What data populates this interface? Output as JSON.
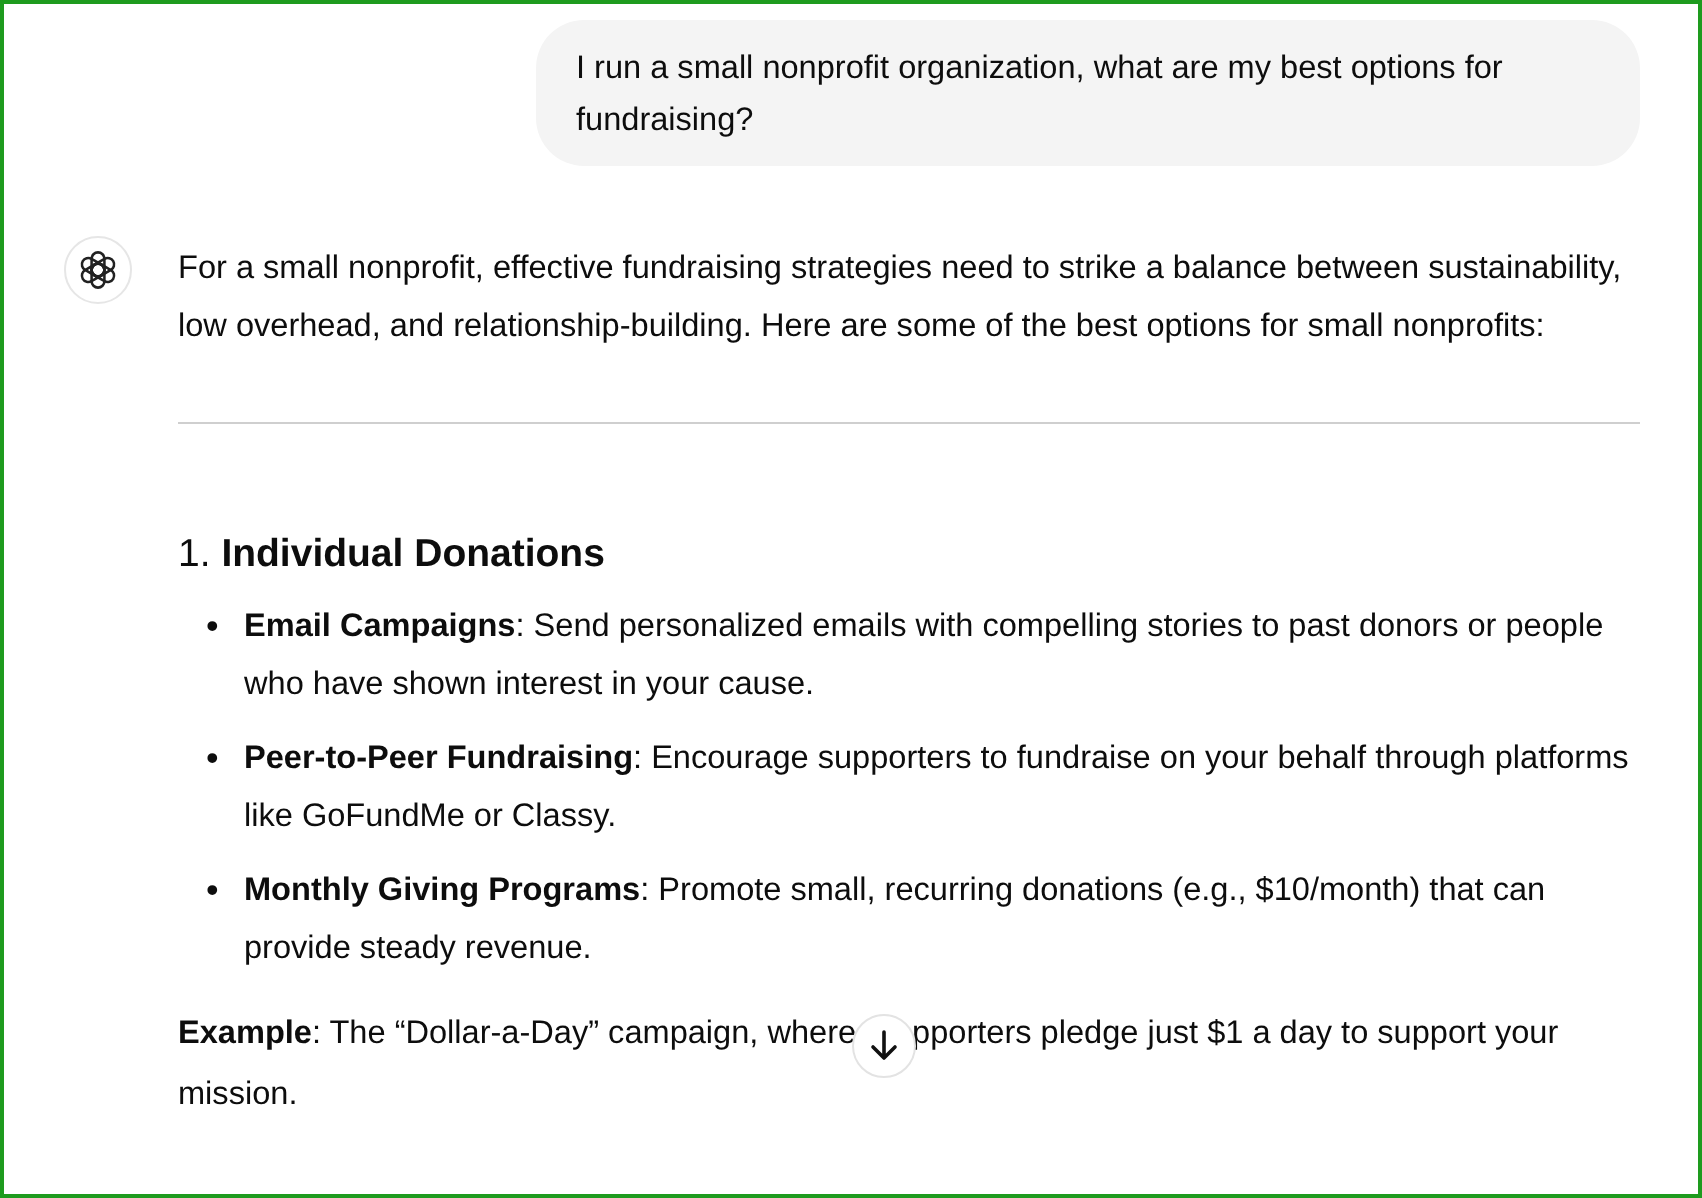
{
  "user_message": {
    "text": "I run a small nonprofit organization, what are my best options for fundraising?"
  },
  "assistant": {
    "intro": "For a small nonprofit, effective fundraising strategies need to strike a balance between sustainability, low overhead, and relationship-building. Here are some of the best options for small nonprofits:",
    "sections": [
      {
        "heading": "1. **Individual Donations**",
        "items": [
          {
            "marker": "•",
            "text": "**Email Campaigns**: Send personalized emails with compelling stories to past donors or people who have shown interest in your cause."
          },
          {
            "marker": "•",
            "text": "**Peer-to-Peer Fundraising**: Encourage supporters to fundraise on your behalf through platforms like GoFundMe or Classy."
          },
          {
            "marker": "•",
            "text": "**Monthly Giving Programs**: Promote small, recurring donations (e.g., $10/month) that can provide steady revenue."
          }
        ]
      }
    ],
    "example": {
      "text_before": "**Example**: The “Dollar-a-Day” campaign, where",
      "text_after": "pporters pledge just $1 a day to support your",
      "text_next_line": "mission."
    }
  }
}
